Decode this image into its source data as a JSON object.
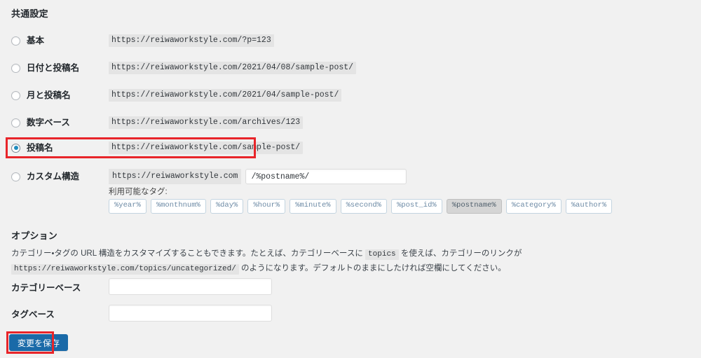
{
  "common_settings": {
    "heading": "共通設定",
    "options": [
      {
        "label": "基本",
        "url": "https://reiwaworkstyle.com/?p=123",
        "selected": false
      },
      {
        "label": "日付と投稿名",
        "url": "https://reiwaworkstyle.com/2021/04/08/sample-post/",
        "selected": false
      },
      {
        "label": "月と投稿名",
        "url": "https://reiwaworkstyle.com/2021/04/sample-post/",
        "selected": false
      },
      {
        "label": "数字ベース",
        "url": "https://reiwaworkstyle.com/archives/123",
        "selected": false
      },
      {
        "label": "投稿名",
        "url": "https://reiwaworkstyle.com/sample-post/",
        "selected": true
      },
      {
        "label": "カスタム構造",
        "url": "",
        "selected": false
      }
    ],
    "custom_structure": {
      "label": "カスタム構造",
      "prefix": "https://reiwaworkstyle.com",
      "value": "/%postname%/",
      "placeholder": ""
    },
    "available_tags_label": "利用可能なタグ:",
    "tags": [
      {
        "label": "%year%",
        "active": false
      },
      {
        "label": "%monthnum%",
        "active": false
      },
      {
        "label": "%day%",
        "active": false
      },
      {
        "label": "%hour%",
        "active": false
      },
      {
        "label": "%minute%",
        "active": false
      },
      {
        "label": "%second%",
        "active": false
      },
      {
        "label": "%post_id%",
        "active": false
      },
      {
        "label": "%postname%",
        "active": true
      },
      {
        "label": "%category%",
        "active": false
      },
      {
        "label": "%author%",
        "active": false
      }
    ]
  },
  "options_section": {
    "heading": "オプション",
    "description_part1": "カテゴリー・タグの URL 構造をカスタマイズすることもできます。たとえば、カテゴリーベースに ",
    "description_code1": "topics",
    "description_part2": " を使えば、カテゴリーのリンクが ",
    "description_code2": "https://reiwaworkstyle.com/topics/uncategorized/",
    "description_part3": " のようになります。デフォルトのままにしたければ空欄にしてください。",
    "category_base": {
      "label": "カテゴリーベース",
      "value": "",
      "placeholder": ""
    },
    "tag_base": {
      "label": "タグベース",
      "value": "",
      "placeholder": ""
    }
  },
  "save_button": {
    "label": "変更を保存"
  },
  "annotations": {
    "highlight_color": "#e8252a",
    "accent_color": "#1a6aa8",
    "radio_dot_color": "#1e8cbe"
  }
}
